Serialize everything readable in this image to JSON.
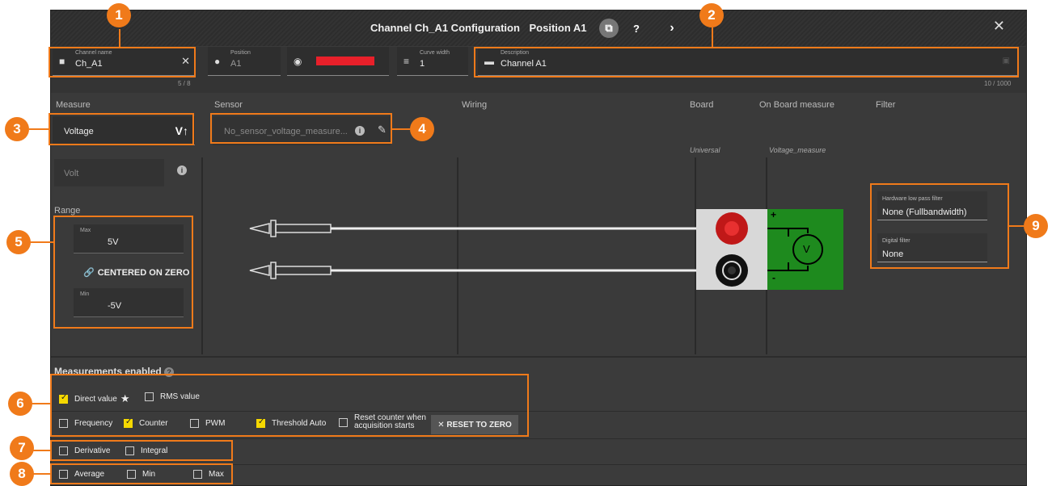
{
  "window": {
    "title_channel": "Channel Ch_A1 Configuration",
    "title_position": "Position A1",
    "copy_icon": "copy-icon",
    "help_icon": "help-icon",
    "next_icon": "chevron-right-icon",
    "close_icon": "close-icon"
  },
  "fields": {
    "channel_name": {
      "label": "Channel name",
      "value": "Ch_A1",
      "counter": "5 / 8"
    },
    "position": {
      "label": "Position",
      "value": "A1"
    },
    "color": {
      "value": "#e8202a"
    },
    "curve_width": {
      "label": "Curve width",
      "value": "1"
    },
    "description": {
      "label": "Description",
      "value": "Channel A1",
      "counter": "10 / 1000"
    }
  },
  "columns": {
    "measure": "Measure",
    "sensor": "Sensor",
    "wiring": "Wiring",
    "board": "Board",
    "on_board": "On Board measure",
    "filter": "Filter"
  },
  "measure": {
    "value": "Voltage",
    "icon_text": "V↑"
  },
  "sensor": {
    "value": "No_sensor_voltage_measure..."
  },
  "unit": {
    "value": "Volt"
  },
  "range": {
    "label": "Range",
    "max_label": "Max",
    "max_value": "5V",
    "centered_label": "CENTERED ON ZERO",
    "min_label": "Min",
    "min_value": "-5V"
  },
  "board": {
    "name": "Universal"
  },
  "on_board": {
    "name": "Voltage_measure",
    "plus": "+",
    "minus": "-",
    "meter": "V"
  },
  "filters": {
    "hw_label": "Hardware low pass filter",
    "hw_value": "None (Fullbandwidth)",
    "digital_label": "Digital filter",
    "digital_value": "None"
  },
  "measurements": {
    "title": "Measurements enabled",
    "direct_value": "Direct value",
    "rms_value": "RMS value",
    "frequency": "Frequency",
    "counter": "Counter",
    "pwm": "PWM",
    "threshold_auto": "Threshold Auto",
    "reset_counter_1": "Reset counter when",
    "reset_counter_2": "acquisition starts",
    "reset_button": "✕  RESET TO ZERO",
    "derivative": "Derivative",
    "integral": "Integral",
    "average": "Average",
    "min": "Min",
    "max": "Max"
  },
  "callouts": [
    "1",
    "2",
    "3",
    "4",
    "5",
    "6",
    "7",
    "8",
    "9"
  ],
  "colors": {
    "accent": "#f07a1a",
    "check": "#f5d800",
    "board_green": "#1e8a1e"
  }
}
